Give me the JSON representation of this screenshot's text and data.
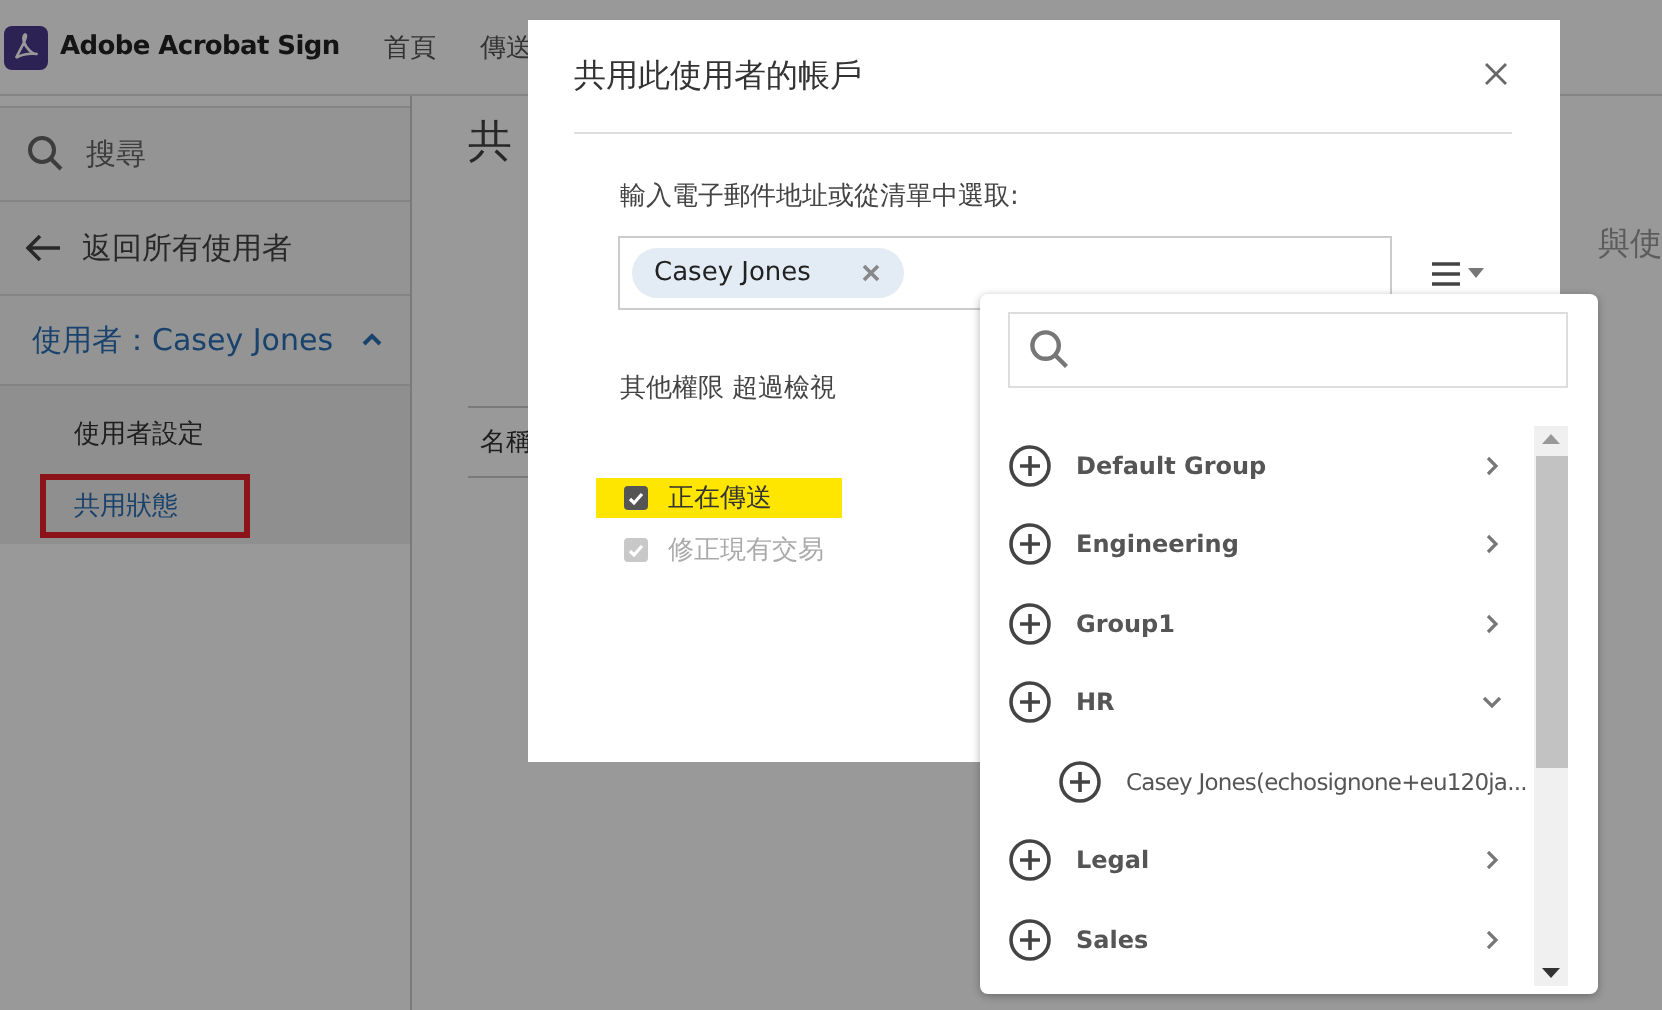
{
  "app": {
    "name": "Adobe Acrobat Sign"
  },
  "nav": [
    {
      "label": "首頁"
    },
    {
      "label": "傳送"
    }
  ],
  "sidebar": {
    "search_placeholder": "搜尋",
    "back": "返回所有使用者",
    "user_header": "使用者：Casey Jones",
    "expanded": true,
    "items": [
      {
        "label": "使用者設定",
        "selected": false
      },
      {
        "label": "共用狀態",
        "selected": true
      }
    ]
  },
  "main": {
    "title": "共",
    "column_header": "名稱",
    "right_text": "與使"
  },
  "dialog": {
    "title": "共用此使用者的帳戶",
    "email_label": "輸入電子郵件地址或從清單中選取:",
    "chips": [
      {
        "label": "Casey Jones"
      }
    ],
    "permissions_label": "其他權限 超過檢視",
    "options": [
      {
        "label": "正在傳送",
        "checked": true,
        "disabled": false,
        "highlighted": true
      },
      {
        "label": "修正現有交易",
        "checked": true,
        "disabled": true,
        "highlighted": false
      }
    ]
  },
  "dropdown": {
    "groups": [
      {
        "label": "Default Group",
        "expanded": false
      },
      {
        "label": "Engineering",
        "expanded": false
      },
      {
        "label": "Group1",
        "expanded": false
      },
      {
        "label": "HR",
        "expanded": true,
        "children": [
          {
            "label": "Casey Jones(echosignone+eu120ja..."
          }
        ]
      },
      {
        "label": "Legal",
        "expanded": false
      },
      {
        "label": "Sales",
        "expanded": false
      }
    ]
  }
}
